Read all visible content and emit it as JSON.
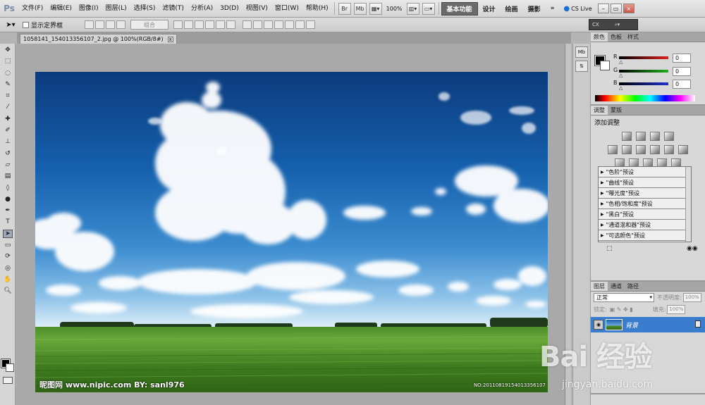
{
  "app": {
    "logo": "Ps"
  },
  "menu": [
    "文件(F)",
    "编辑(E)",
    "图像(I)",
    "图层(L)",
    "选择(S)",
    "滤镜(T)",
    "分析(A)",
    "3D(D)",
    "视图(V)",
    "窗口(W)",
    "帮助(H)"
  ],
  "menubar_tools": {
    "br_label": "Br",
    "mb_label": "Mb",
    "zoom": "100%"
  },
  "workspaces": {
    "active": "基本功能",
    "items": [
      "设计",
      "绘画",
      "摄影"
    ],
    "more": "»"
  },
  "cslive": "CS Live",
  "options_bar": {
    "show_bounds": "显示定界框",
    "combine": "组合"
  },
  "search_box": {
    "placeholder": "CX"
  },
  "document": {
    "tab_title": "1058141_154013356107_2.jpg @ 100%(RGB/8#)",
    "close": "x"
  },
  "watermark": {
    "left": "昵图网 www.nipic.com   BY: sanl976",
    "right": "NO:20110819154013356107"
  },
  "color_panel": {
    "tabs": [
      "颜色",
      "色板",
      "样式"
    ],
    "r_label": "R",
    "g_label": "G",
    "b_label": "B",
    "r": "0",
    "g": "0",
    "b": "0",
    "colors": {
      "r": "#e02020",
      "g": "#20b020",
      "b": "#2030d0"
    }
  },
  "adjust_panel": {
    "tabs": [
      "调整",
      "蒙版"
    ],
    "title": "添加调整",
    "presets": [
      "\"色阶\"预设",
      "\"曲线\"预设",
      "\"曝光度\"预设",
      "\"色相/饱和度\"预设",
      "\"黑白\"预设",
      "\"通道混和器\"预设",
      "\"可选颜色\"预设"
    ]
  },
  "layers_panel": {
    "tabs": [
      "图层",
      "通道",
      "路径"
    ],
    "blend_mode": "正常",
    "opacity_label": "不透明度:",
    "opacity": "100%",
    "lock_label": "锁定:",
    "fill_label": "填充:",
    "fill": "100%",
    "layer_name": "背景"
  },
  "site_watermark": {
    "logo": "Bai 经验",
    "url": "jingyan.baidu.com"
  }
}
